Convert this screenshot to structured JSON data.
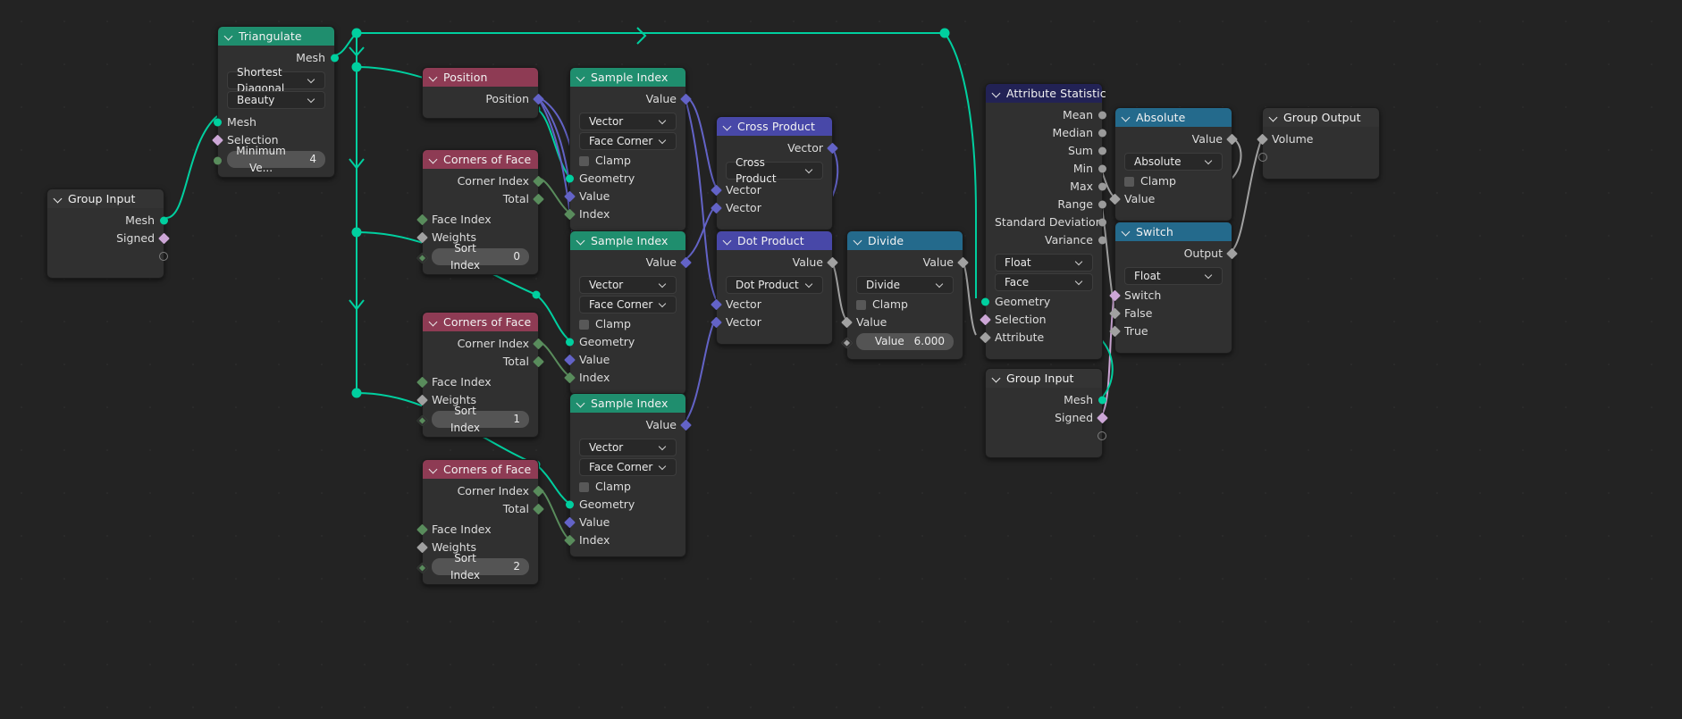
{
  "app": {
    "name": "Blender Geometry Node Editor",
    "background": "#232323",
    "link_color_geometry": "#00cf9f",
    "link_color_vector": "#6363c7",
    "link_color_float": "#a1a1a1",
    "link_color_int": "#598c5c",
    "link_color_bool": "#cca6d6"
  },
  "nodes": {
    "group_input_left": {
      "title": "Group Input",
      "outputs": [
        {
          "label": "Mesh",
          "type": "geometry"
        },
        {
          "label": "Signed",
          "type": "boolean"
        },
        {
          "label": "",
          "type": "virtual"
        }
      ]
    },
    "triangulate": {
      "title": "Triangulate",
      "outputs": [
        {
          "label": "Mesh",
          "type": "geometry"
        }
      ],
      "dropdowns": [
        {
          "name": "quad_method",
          "value": "Shortest Diagonal"
        },
        {
          "name": "ngon_method",
          "value": "Beauty"
        }
      ],
      "inputs": [
        {
          "label": "Mesh",
          "type": "geometry"
        },
        {
          "label": "Selection",
          "type": "boolean"
        }
      ],
      "value_widgets": [
        {
          "label": "Minimum Ve...",
          "value": "4",
          "type": "int"
        }
      ]
    },
    "position": {
      "title": "Position",
      "outputs": [
        {
          "label": "Position",
          "type": "vector"
        }
      ]
    },
    "corners_of_face_0": {
      "title": "Corners of Face",
      "outputs": [
        {
          "label": "Corner Index",
          "type": "int"
        },
        {
          "label": "Total",
          "type": "int"
        }
      ],
      "inputs": [
        {
          "label": "Face Index",
          "type": "int"
        },
        {
          "label": "Weights",
          "type": "float"
        }
      ],
      "value_widgets": [
        {
          "label": "Sort Index",
          "value": "0",
          "type": "int"
        }
      ]
    },
    "corners_of_face_1": {
      "title": "Corners of Face",
      "outputs": [
        {
          "label": "Corner Index",
          "type": "int"
        },
        {
          "label": "Total",
          "type": "int"
        }
      ],
      "inputs": [
        {
          "label": "Face Index",
          "type": "int"
        },
        {
          "label": "Weights",
          "type": "float"
        }
      ],
      "value_widgets": [
        {
          "label": "Sort Index",
          "value": "1",
          "type": "int"
        }
      ]
    },
    "corners_of_face_2": {
      "title": "Corners of Face",
      "outputs": [
        {
          "label": "Corner Index",
          "type": "int"
        },
        {
          "label": "Total",
          "type": "int"
        }
      ],
      "inputs": [
        {
          "label": "Face Index",
          "type": "int"
        },
        {
          "label": "Weights",
          "type": "float"
        }
      ],
      "value_widgets": [
        {
          "label": "Sort Index",
          "value": "2",
          "type": "int"
        }
      ]
    },
    "sample_index_0": {
      "title": "Sample Index",
      "outputs": [
        {
          "label": "Value",
          "type": "vector"
        }
      ],
      "dropdowns": [
        {
          "name": "data_type",
          "value": "Vector"
        },
        {
          "name": "domain",
          "value": "Face Corner"
        }
      ],
      "checkbox": {
        "label": "Clamp",
        "checked": false
      },
      "inputs": [
        {
          "label": "Geometry",
          "type": "geometry"
        },
        {
          "label": "Value",
          "type": "vector"
        },
        {
          "label": "Index",
          "type": "int"
        }
      ]
    },
    "sample_index_1": {
      "title": "Sample Index",
      "outputs": [
        {
          "label": "Value",
          "type": "vector"
        }
      ],
      "dropdowns": [
        {
          "name": "data_type",
          "value": "Vector"
        },
        {
          "name": "domain",
          "value": "Face Corner"
        }
      ],
      "checkbox": {
        "label": "Clamp",
        "checked": false
      },
      "inputs": [
        {
          "label": "Geometry",
          "type": "geometry"
        },
        {
          "label": "Value",
          "type": "vector"
        },
        {
          "label": "Index",
          "type": "int"
        }
      ]
    },
    "sample_index_2": {
      "title": "Sample Index",
      "outputs": [
        {
          "label": "Value",
          "type": "vector"
        }
      ],
      "dropdowns": [
        {
          "name": "data_type",
          "value": "Vector"
        },
        {
          "name": "domain",
          "value": "Face Corner"
        }
      ],
      "checkbox": {
        "label": "Clamp",
        "checked": false
      },
      "inputs": [
        {
          "label": "Geometry",
          "type": "geometry"
        },
        {
          "label": "Value",
          "type": "vector"
        },
        {
          "label": "Index",
          "type": "int"
        }
      ]
    },
    "cross_product": {
      "title": "Cross Product",
      "outputs": [
        {
          "label": "Vector",
          "type": "vector"
        }
      ],
      "dropdowns": [
        {
          "name": "operation",
          "value": "Cross Product"
        }
      ],
      "inputs": [
        {
          "label": "Vector",
          "type": "vector"
        },
        {
          "label": "Vector",
          "type": "vector"
        }
      ]
    },
    "dot_product": {
      "title": "Dot Product",
      "outputs": [
        {
          "label": "Value",
          "type": "float"
        }
      ],
      "dropdowns": [
        {
          "name": "operation",
          "value": "Dot Product"
        }
      ],
      "inputs": [
        {
          "label": "Vector",
          "type": "vector"
        },
        {
          "label": "Vector",
          "type": "vector"
        }
      ]
    },
    "divide": {
      "title": "Divide",
      "outputs": [
        {
          "label": "Value",
          "type": "float"
        }
      ],
      "dropdowns": [
        {
          "name": "operation",
          "value": "Divide"
        }
      ],
      "checkbox": {
        "label": "Clamp",
        "checked": false
      },
      "inputs": [
        {
          "label": "Value",
          "type": "float"
        }
      ],
      "value_widgets": [
        {
          "label": "Value",
          "value": "6.000",
          "type": "float"
        }
      ]
    },
    "attribute_statistic": {
      "title": "Attribute Statistic",
      "outputs": [
        {
          "label": "Mean",
          "type": "float"
        },
        {
          "label": "Median",
          "type": "float"
        },
        {
          "label": "Sum",
          "type": "float"
        },
        {
          "label": "Min",
          "type": "float"
        },
        {
          "label": "Max",
          "type": "float"
        },
        {
          "label": "Range",
          "type": "float"
        },
        {
          "label": "Standard Deviation",
          "type": "float"
        },
        {
          "label": "Variance",
          "type": "float"
        }
      ],
      "dropdowns": [
        {
          "name": "data_type",
          "value": "Float"
        },
        {
          "name": "domain",
          "value": "Face"
        }
      ],
      "inputs": [
        {
          "label": "Geometry",
          "type": "geometry"
        },
        {
          "label": "Selection",
          "type": "boolean"
        },
        {
          "label": "Attribute",
          "type": "float"
        }
      ]
    },
    "absolute": {
      "title": "Absolute",
      "outputs": [
        {
          "label": "Value",
          "type": "float"
        }
      ],
      "dropdowns": [
        {
          "name": "operation",
          "value": "Absolute"
        }
      ],
      "checkbox": {
        "label": "Clamp",
        "checked": false
      },
      "inputs": [
        {
          "label": "Value",
          "type": "float"
        }
      ]
    },
    "switch": {
      "title": "Switch",
      "outputs": [
        {
          "label": "Output",
          "type": "float"
        }
      ],
      "dropdowns": [
        {
          "name": "input_type",
          "value": "Float"
        }
      ],
      "inputs": [
        {
          "label": "Switch",
          "type": "boolean"
        },
        {
          "label": "False",
          "type": "float"
        },
        {
          "label": "True",
          "type": "float"
        }
      ]
    },
    "group_input_bottom": {
      "title": "Group Input",
      "outputs": [
        {
          "label": "Mesh",
          "type": "geometry"
        },
        {
          "label": "Signed",
          "type": "boolean"
        },
        {
          "label": "",
          "type": "virtual"
        }
      ]
    },
    "group_output": {
      "title": "Group Output",
      "inputs": [
        {
          "label": "Volume",
          "type": "float"
        },
        {
          "label": "",
          "type": "virtual"
        }
      ]
    }
  }
}
